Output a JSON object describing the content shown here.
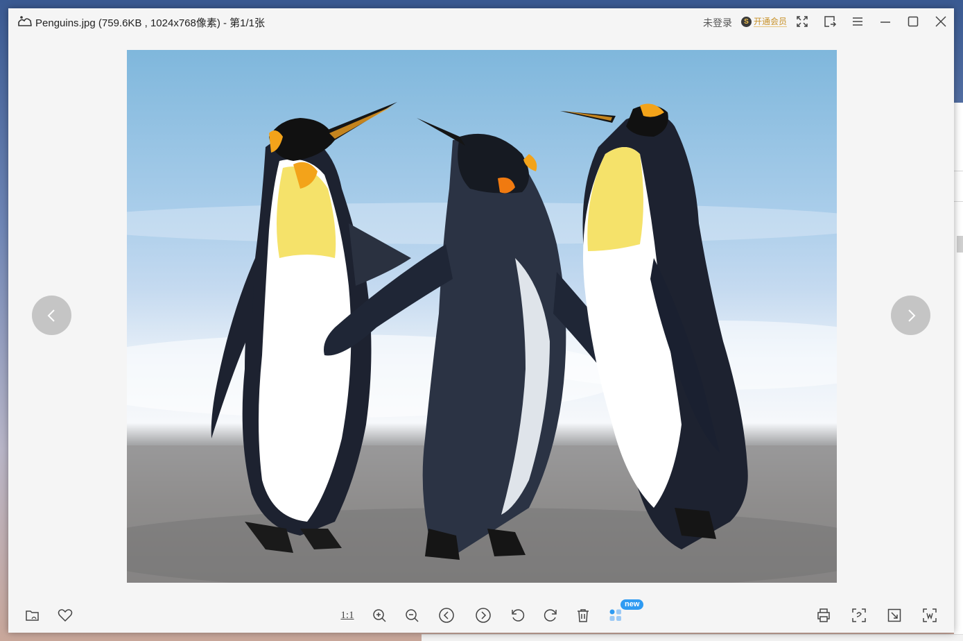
{
  "window": {
    "title": "Penguins.jpg (759.6KB , 1024x768像素) - 第1/1张",
    "login_label": "未登录",
    "vip_badge": "S",
    "vip_label": "开通会员"
  },
  "titlebar_buttons": [
    {
      "name": "fullscreen-icon"
    },
    {
      "name": "open-with-icon"
    },
    {
      "name": "menu-icon"
    },
    {
      "name": "minimize-icon"
    },
    {
      "name": "maximize-icon"
    },
    {
      "name": "close-icon"
    }
  ],
  "toolbar": {
    "actual_size_label": "1:1",
    "new_badge": "new",
    "left_tools": [
      "open-folder-icon",
      "favorite-heart-icon"
    ],
    "center_tools": [
      "actual-size-button",
      "zoom-in-icon",
      "zoom-out-icon",
      "previous-icon",
      "next-icon",
      "rotate-left-icon",
      "rotate-right-icon",
      "delete-icon",
      "apps-grid-icon"
    ],
    "right_tools": [
      "print-icon",
      "ocr-scan-icon",
      "crop-resize-icon",
      "screenshot-icon"
    ]
  },
  "colors": {
    "window_bg": "#f5f5f5",
    "accent_blue": "#2f9bf2",
    "vip_gold": "#c8922a",
    "icon_gray": "#444444"
  }
}
